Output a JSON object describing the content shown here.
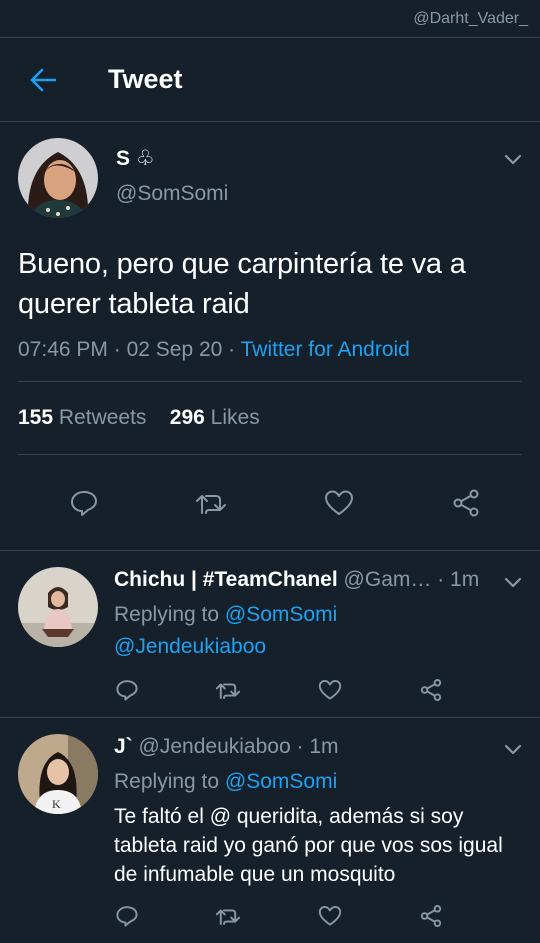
{
  "watermark": "@Darht_Vader_",
  "header": {
    "title": "Tweet"
  },
  "main_tweet": {
    "name": "S ♧",
    "handle": "@SomSomi",
    "text": "Bueno, pero que carpintería te va a querer tableta raid",
    "time": "07:46 PM",
    "date": "02 Sep 20",
    "source": "Twitter for Android",
    "retweets_count": "155",
    "retweets_label": "Retweets",
    "likes_count": "296",
    "likes_label": "Likes"
  },
  "replies": [
    {
      "name": "Chichu | #TeamChanel",
      "handle": "@Gam…",
      "time": "1m",
      "replying_prefix": "Replying to",
      "replying_to": "@SomSomi",
      "replying_to_2": "@Jendeukiaboo",
      "text": ""
    },
    {
      "name": "J`",
      "handle": "@Jendeukiaboo",
      "time": "1m",
      "replying_prefix": "Replying to",
      "replying_to": "@SomSomi",
      "text": "Te faltó el @ queridita, además si soy tableta raid yo ganó por que vos sos igual de infumable que un mosquito"
    }
  ],
  "colors": {
    "background": "#15202b",
    "divider": "#38444d",
    "secondary_text": "#8899a6",
    "accent": "#1da1f2"
  },
  "icons": [
    "back-arrow-icon",
    "chevron-down-icon",
    "reply-icon",
    "retweet-icon",
    "like-icon",
    "share-icon"
  ]
}
